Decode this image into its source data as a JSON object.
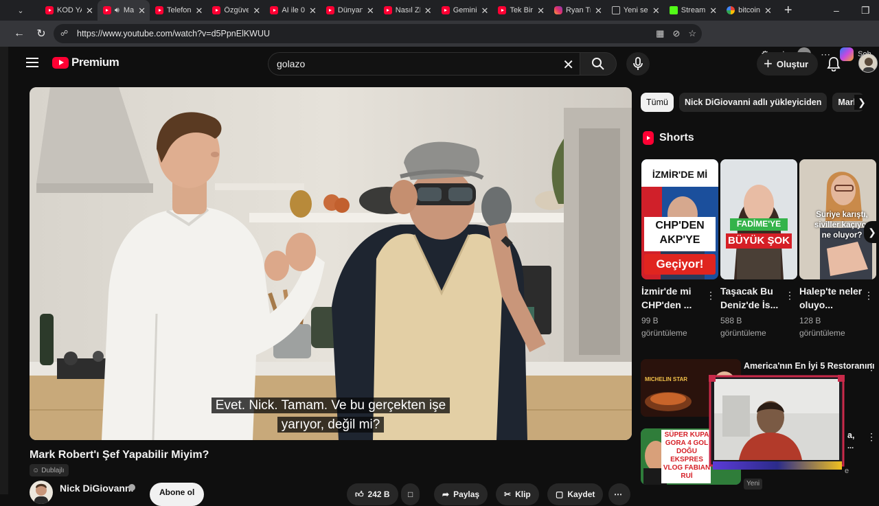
{
  "browser": {
    "tabs": [
      {
        "title": "KOD YA",
        "icon": "youtube-icon"
      },
      {
        "title": "Ma",
        "icon": "youtube-icon",
        "active": true,
        "audio": true
      },
      {
        "title": "Telefon",
        "icon": "youtube-icon"
      },
      {
        "title": "Özgüve",
        "icon": "youtube-icon"
      },
      {
        "title": "AI ile 0",
        "icon": "youtube-icon"
      },
      {
        "title": "Dünyan",
        "icon": "youtube-icon"
      },
      {
        "title": "Nasıl ZE",
        "icon": "youtube-icon"
      },
      {
        "title": "Gemini",
        "icon": "youtube-icon"
      },
      {
        "title": "Tek Bir",
        "icon": "youtube-icon"
      },
      {
        "title": "Ryan Tr",
        "icon": "instagram-icon"
      },
      {
        "title": "Yeni sek",
        "icon": "document-icon"
      },
      {
        "title": "Stream",
        "icon": "kick-icon"
      },
      {
        "title": "bitcoin",
        "icon": "google-icon"
      }
    ],
    "url": "https://www.youtube.com/watch?v=d5PpnElKWUU",
    "copilot_label": "Soh"
  },
  "header": {
    "logo_text": "Premium",
    "search_value": "golazo",
    "create_label": "Oluştur"
  },
  "video": {
    "caption_line1": "Evet. Nick. Tamam. Ve bu gerçekten işe",
    "caption_line2": "yarıyor, değil mi?",
    "title": "Mark Robert'ı Şef Yapabilir Miyim?",
    "dub_label": "Dublajlı",
    "channel": "Nick DiGiovanni",
    "subscribe_label": "Abone ol",
    "likes": "242 B",
    "share_label": "Paylaş",
    "clip_label": "Klip",
    "save_label": "Kaydet"
  },
  "sidebar": {
    "chips": [
      "Tümü",
      "Nick DiGiovanni adlı yükleyiciden",
      "Mark"
    ],
    "shorts_heading": "Shorts",
    "shorts": [
      {
        "title": "İzmir'de mi CHP'den ...",
        "views": "99 B",
        "views_label": "görüntüleme",
        "thumb_top": "İZMİR'DE Mİ",
        "thumb_mid": "CHP'DEN AKP'YE",
        "thumb_bot": "Geçiyor!"
      },
      {
        "title": "Taşacak Bu Deniz'de İs...",
        "views": "588 B",
        "views_label": "görüntüleme",
        "thumb_top": "FADİME'YE",
        "thumb_bot": "BÜYÜK ŞOK"
      },
      {
        "title": "Halep'te neler oluyo...",
        "views": "128 B",
        "views_label": "görüntüleme",
        "thumb_mid": "Suriye karıştı, siviller kaçıyor ne oluyor?"
      }
    ],
    "related": [
      {
        "title": "America'nın En İyi 5 Restoranını",
        "thumb_text": "MICHELIN STAR"
      },
      {
        "title": "a,",
        "thumb_text": "SÜPER KUPA GORA 4 GOL DOĞU EKSPRES VLOG FABIAN RUİ",
        "badge": "Yeni",
        "extra": "...",
        "side_letter": "e"
      }
    ]
  }
}
